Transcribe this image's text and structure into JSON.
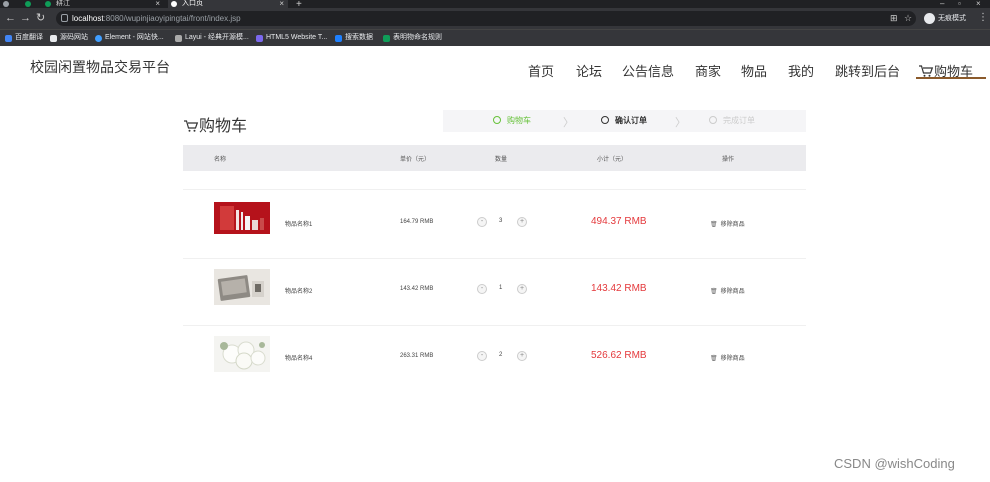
{
  "browser": {
    "tabs": [
      {
        "label": "",
        "active": false
      },
      {
        "label": "····",
        "active": false
      },
      {
        "label": "耕江",
        "active": false
      },
      {
        "label": "入口页",
        "active": true
      }
    ],
    "new_tab": "+",
    "url_host": "localhost",
    "url_rest": ":8080/wupinjiaoyipingtai/front/index.jsp",
    "profile_label": "无痕模式",
    "bookmarks": [
      "百度翻译",
      "源码网站",
      "Element - 网站快...",
      "Layui - 经典开源模...",
      "HTML5 Website T...",
      "搜索数据",
      "表明物命名规则"
    ]
  },
  "site": {
    "title": "校园闲置物品交易平台",
    "nav": [
      "首页",
      "论坛",
      "公告信息",
      "商家",
      "物品",
      "我的",
      "跳转到后台"
    ],
    "cart_nav_label": "购物车"
  },
  "cart": {
    "title": "购物车",
    "steps": [
      "购物车",
      "确认订单",
      "完成订单"
    ],
    "headers": {
      "name": "名称",
      "unit_price": "单价（元）",
      "quantity": "数量",
      "subtotal": "小计（元）",
      "action": "操作"
    },
    "items": [
      {
        "name": "物品名称1",
        "price": "164.79 RMB",
        "qty": "3",
        "subtotal": "494.37 RMB",
        "remove": "移除商品"
      },
      {
        "name": "物品名称2",
        "price": "143.42 RMB",
        "qty": "1",
        "subtotal": "143.42 RMB",
        "remove": "移除商品"
      },
      {
        "name": "物品名称4",
        "price": "263.31 RMB",
        "qty": "2",
        "subtotal": "526.62 RMB",
        "remove": "移除商品"
      }
    ],
    "minus": "-",
    "plus": "+",
    "trash": "🗑"
  },
  "watermark": "CSDN @wishCoding",
  "colors": {
    "accent_green": "#67c23a",
    "price_red": "#e4393c",
    "nav_underline": "#8b5a2b"
  }
}
